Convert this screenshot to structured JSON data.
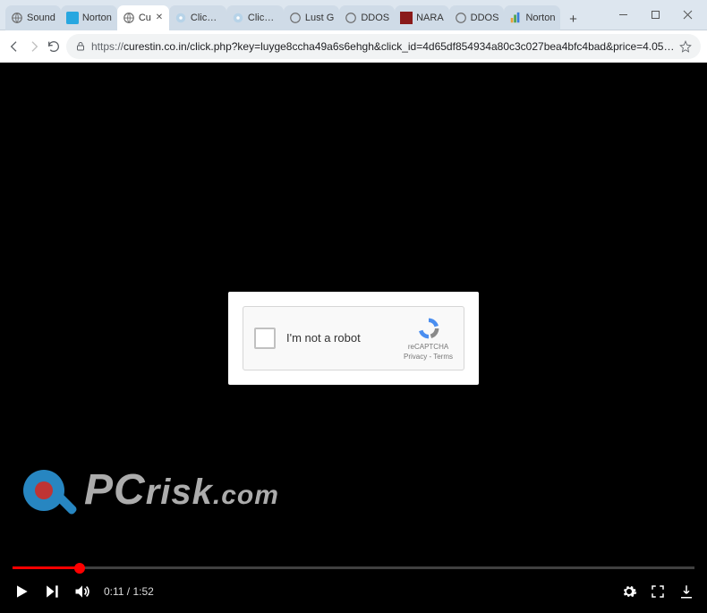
{
  "window": {
    "tabs": [
      {
        "label": "Sound",
        "icon": "globe"
      },
      {
        "label": "Norton",
        "icon": "n-blue"
      },
      {
        "label": "Cu",
        "icon": "globe",
        "active": true
      },
      {
        "label": "Click &",
        "icon": "cog"
      },
      {
        "label": "Click &",
        "icon": "cog"
      },
      {
        "label": "Lust G",
        "icon": "globe"
      },
      {
        "label": "DDOS",
        "icon": "globe"
      },
      {
        "label": "NARA",
        "icon": "red-sq"
      },
      {
        "label": "DDOS",
        "icon": "globe"
      },
      {
        "label": "Norton",
        "icon": "bars"
      }
    ]
  },
  "address": {
    "scheme": "https://",
    "rest": "curestin.co.in/click.php?key=luyge8ccha49a6s6ehgh&click_id=4d65df854934a80c3c027bea4bfc4bad&price=4.05…"
  },
  "captcha": {
    "label": "I'm not a robot",
    "brand": "reCAPTCHA",
    "legal": "Privacy - Terms"
  },
  "watermark": {
    "brand_p": "P",
    "brand_c": "C",
    "brand_risk": "risk",
    "brand_dom": ".com"
  },
  "player": {
    "current": "0:11",
    "sep": " / ",
    "total": "1:52",
    "progress_pct": 9.82
  }
}
